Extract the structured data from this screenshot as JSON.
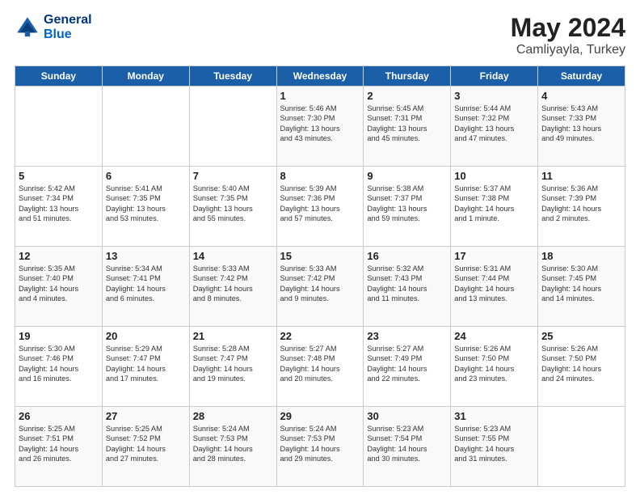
{
  "header": {
    "logo_line1": "General",
    "logo_line2": "Blue",
    "month_title": "May 2024",
    "location": "Camliyayla, Turkey"
  },
  "weekdays": [
    "Sunday",
    "Monday",
    "Tuesday",
    "Wednesday",
    "Thursday",
    "Friday",
    "Saturday"
  ],
  "weeks": [
    [
      {
        "day": "",
        "info": ""
      },
      {
        "day": "",
        "info": ""
      },
      {
        "day": "",
        "info": ""
      },
      {
        "day": "1",
        "info": "Sunrise: 5:46 AM\nSunset: 7:30 PM\nDaylight: 13 hours\nand 43 minutes."
      },
      {
        "day": "2",
        "info": "Sunrise: 5:45 AM\nSunset: 7:31 PM\nDaylight: 13 hours\nand 45 minutes."
      },
      {
        "day": "3",
        "info": "Sunrise: 5:44 AM\nSunset: 7:32 PM\nDaylight: 13 hours\nand 47 minutes."
      },
      {
        "day": "4",
        "info": "Sunrise: 5:43 AM\nSunset: 7:33 PM\nDaylight: 13 hours\nand 49 minutes."
      }
    ],
    [
      {
        "day": "5",
        "info": "Sunrise: 5:42 AM\nSunset: 7:34 PM\nDaylight: 13 hours\nand 51 minutes."
      },
      {
        "day": "6",
        "info": "Sunrise: 5:41 AM\nSunset: 7:35 PM\nDaylight: 13 hours\nand 53 minutes."
      },
      {
        "day": "7",
        "info": "Sunrise: 5:40 AM\nSunset: 7:35 PM\nDaylight: 13 hours\nand 55 minutes."
      },
      {
        "day": "8",
        "info": "Sunrise: 5:39 AM\nSunset: 7:36 PM\nDaylight: 13 hours\nand 57 minutes."
      },
      {
        "day": "9",
        "info": "Sunrise: 5:38 AM\nSunset: 7:37 PM\nDaylight: 13 hours\nand 59 minutes."
      },
      {
        "day": "10",
        "info": "Sunrise: 5:37 AM\nSunset: 7:38 PM\nDaylight: 14 hours\nand 1 minute."
      },
      {
        "day": "11",
        "info": "Sunrise: 5:36 AM\nSunset: 7:39 PM\nDaylight: 14 hours\nand 2 minutes."
      }
    ],
    [
      {
        "day": "12",
        "info": "Sunrise: 5:35 AM\nSunset: 7:40 PM\nDaylight: 14 hours\nand 4 minutes."
      },
      {
        "day": "13",
        "info": "Sunrise: 5:34 AM\nSunset: 7:41 PM\nDaylight: 14 hours\nand 6 minutes."
      },
      {
        "day": "14",
        "info": "Sunrise: 5:33 AM\nSunset: 7:42 PM\nDaylight: 14 hours\nand 8 minutes."
      },
      {
        "day": "15",
        "info": "Sunrise: 5:33 AM\nSunset: 7:42 PM\nDaylight: 14 hours\nand 9 minutes."
      },
      {
        "day": "16",
        "info": "Sunrise: 5:32 AM\nSunset: 7:43 PM\nDaylight: 14 hours\nand 11 minutes."
      },
      {
        "day": "17",
        "info": "Sunrise: 5:31 AM\nSunset: 7:44 PM\nDaylight: 14 hours\nand 13 minutes."
      },
      {
        "day": "18",
        "info": "Sunrise: 5:30 AM\nSunset: 7:45 PM\nDaylight: 14 hours\nand 14 minutes."
      }
    ],
    [
      {
        "day": "19",
        "info": "Sunrise: 5:30 AM\nSunset: 7:46 PM\nDaylight: 14 hours\nand 16 minutes."
      },
      {
        "day": "20",
        "info": "Sunrise: 5:29 AM\nSunset: 7:47 PM\nDaylight: 14 hours\nand 17 minutes."
      },
      {
        "day": "21",
        "info": "Sunrise: 5:28 AM\nSunset: 7:47 PM\nDaylight: 14 hours\nand 19 minutes."
      },
      {
        "day": "22",
        "info": "Sunrise: 5:27 AM\nSunset: 7:48 PM\nDaylight: 14 hours\nand 20 minutes."
      },
      {
        "day": "23",
        "info": "Sunrise: 5:27 AM\nSunset: 7:49 PM\nDaylight: 14 hours\nand 22 minutes."
      },
      {
        "day": "24",
        "info": "Sunrise: 5:26 AM\nSunset: 7:50 PM\nDaylight: 14 hours\nand 23 minutes."
      },
      {
        "day": "25",
        "info": "Sunrise: 5:26 AM\nSunset: 7:50 PM\nDaylight: 14 hours\nand 24 minutes."
      }
    ],
    [
      {
        "day": "26",
        "info": "Sunrise: 5:25 AM\nSunset: 7:51 PM\nDaylight: 14 hours\nand 26 minutes."
      },
      {
        "day": "27",
        "info": "Sunrise: 5:25 AM\nSunset: 7:52 PM\nDaylight: 14 hours\nand 27 minutes."
      },
      {
        "day": "28",
        "info": "Sunrise: 5:24 AM\nSunset: 7:53 PM\nDaylight: 14 hours\nand 28 minutes."
      },
      {
        "day": "29",
        "info": "Sunrise: 5:24 AM\nSunset: 7:53 PM\nDaylight: 14 hours\nand 29 minutes."
      },
      {
        "day": "30",
        "info": "Sunrise: 5:23 AM\nSunset: 7:54 PM\nDaylight: 14 hours\nand 30 minutes."
      },
      {
        "day": "31",
        "info": "Sunrise: 5:23 AM\nSunset: 7:55 PM\nDaylight: 14 hours\nand 31 minutes."
      },
      {
        "day": "",
        "info": ""
      }
    ]
  ]
}
